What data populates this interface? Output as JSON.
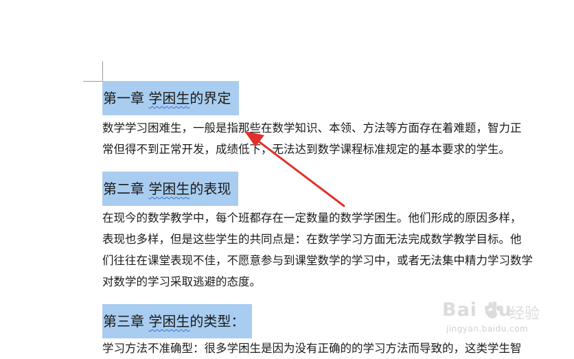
{
  "document": {
    "sections": [
      {
        "heading": {
          "prefix": "第一章 ",
          "wavy": "学困生",
          "suffix": "的界定"
        },
        "lines": [
          "数学学习困难生，一般是指那些在数学知识、本领、方法等方面存在着难题，智力正",
          "常但得不到正常开发，成绩低下，无法达到数学课程标准规定的基本要求的学生。"
        ]
      },
      {
        "heading": {
          "prefix": "第二章 ",
          "wavy": "学困生",
          "suffix": "的表现"
        },
        "lines": [
          "在现今的数学教学中，每个班都存在一定数量的数学学困生。他们形成的原因多样，",
          "表现也多样，但是这些学生的共同点是：在数学学习方面无法完成数学教学目标。他",
          "们往往在课堂表现不佳，不愿意参与到课堂数学的学习中，或者无法集中精力学习数学",
          "对数学的学习采取逃避的态度。"
        ]
      },
      {
        "heading": {
          "prefix": "第三章 ",
          "wavy": "学困生",
          "suffix": "的类型："
        },
        "lines": [
          "学习方法不准确型：很多学困生是因为没有正确的的学习方法而导致的，这类学生智"
        ]
      }
    ]
  },
  "annotation": {
    "arrow_color": "#e0302a"
  },
  "watermark": {
    "logo_text": "Bai  du",
    "jingyan_text": "经验",
    "url_text": "jingyan.baidu.com"
  }
}
